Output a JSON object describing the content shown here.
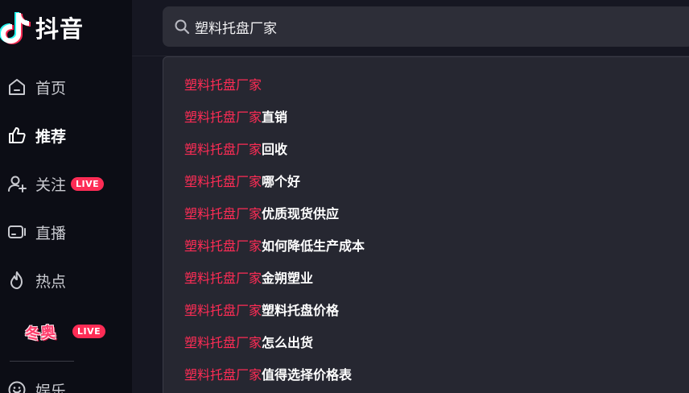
{
  "app": {
    "name": "抖音"
  },
  "sidebar": {
    "items": [
      {
        "label": "首页",
        "icon": "home-icon",
        "active": false
      },
      {
        "label": "推荐",
        "icon": "thumbs-up-icon",
        "active": true
      },
      {
        "label": "关注",
        "icon": "follow-user-icon",
        "badge": "LIVE",
        "active": false
      },
      {
        "label": "直播",
        "icon": "live-camera-icon",
        "active": false
      },
      {
        "label": "热点",
        "icon": "flame-icon",
        "active": false
      }
    ],
    "winter_tag": {
      "text": "冬奥",
      "badge": "LIVE"
    },
    "partial_item": {
      "label": "娱乐",
      "icon": "smile-icon"
    }
  },
  "search": {
    "value": "塑料托盘厂家",
    "icon": "search-icon"
  },
  "suggestions": [
    {
      "highlight": "塑料托盘厂家",
      "rest": ""
    },
    {
      "highlight": "塑料托盘厂家",
      "rest": "直销"
    },
    {
      "highlight": "塑料托盘厂家",
      "rest": "回收"
    },
    {
      "highlight": "塑料托盘厂家",
      "rest": "哪个好"
    },
    {
      "highlight": "塑料托盘厂家",
      "rest": "优质现货供应"
    },
    {
      "highlight": "塑料托盘厂家",
      "rest": "如何降低生产成本"
    },
    {
      "highlight": "塑料托盘厂家",
      "rest": "金朔塑业"
    },
    {
      "highlight": "塑料托盘厂家",
      "rest": "塑料托盘价格"
    },
    {
      "highlight": "塑料托盘厂家",
      "rest": "怎么出货"
    },
    {
      "highlight": "塑料托盘厂家",
      "rest": "值得选择价格表"
    }
  ],
  "colors": {
    "accent": "#fe2c55",
    "sidebar_bg": "#0c0d15",
    "page_bg": "#161722",
    "dropdown_bg": "#262731"
  }
}
